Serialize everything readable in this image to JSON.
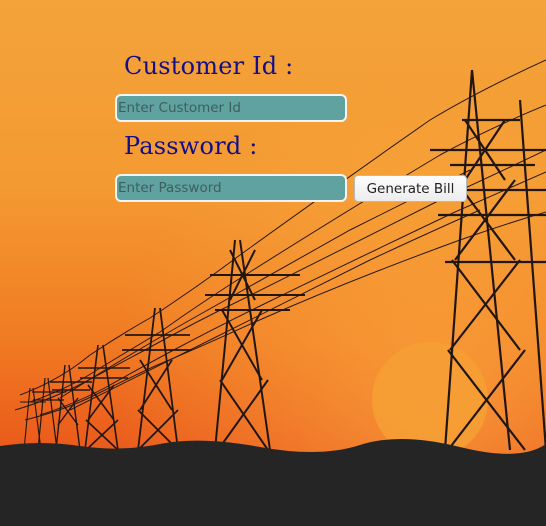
{
  "form": {
    "customer_id_label": "Customer Id :",
    "customer_id_placeholder": "Enter Customer Id",
    "password_label": "Password :",
    "password_placeholder": "Enter Password",
    "generate_button_label": "Generate Bill"
  },
  "colors": {
    "label_text": "#120e8a",
    "input_fill": "#5fa2a0",
    "sky_top": "#f4a63a",
    "sky_horizon": "#ea5a16",
    "ground": "#252525"
  }
}
